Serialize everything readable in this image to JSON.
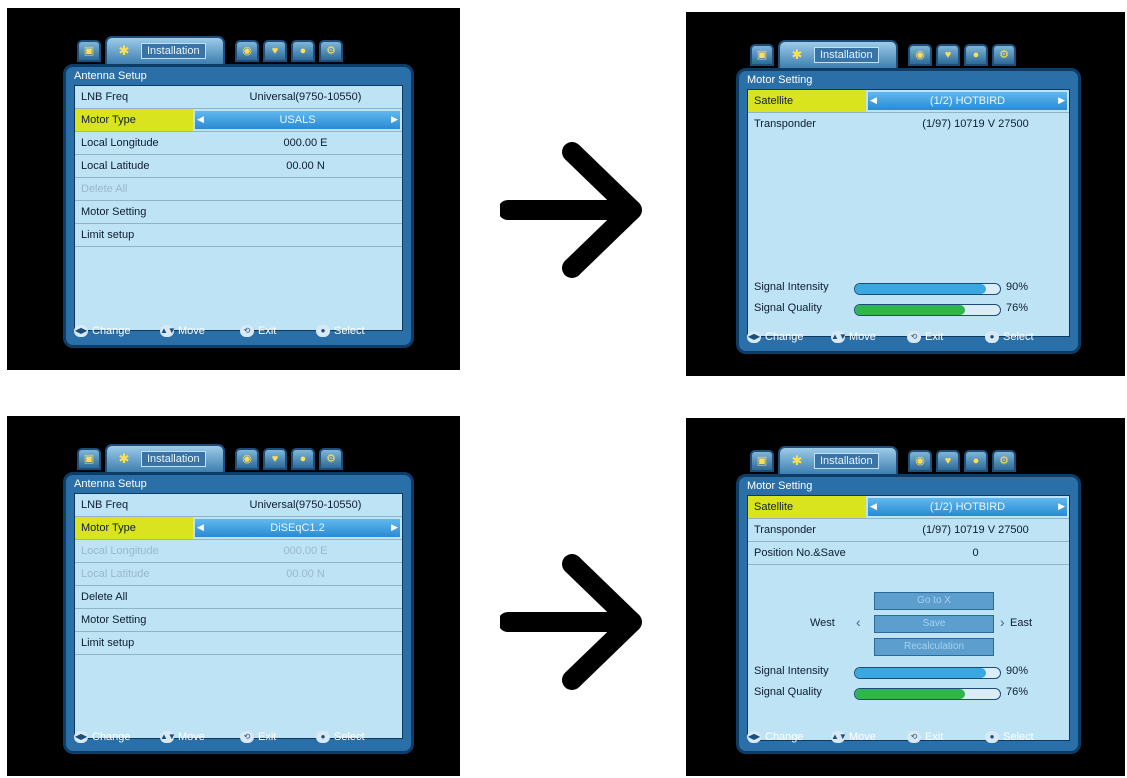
{
  "tabs": {
    "active_label": "Installation",
    "icons": [
      "tv-icon",
      "satellite-dish-icon",
      "parental-lock-icon",
      "favourite-icon",
      "system-icon",
      "settings-icon"
    ]
  },
  "screen_tl": {
    "title": "Antenna Setup",
    "rows": [
      {
        "label": "LNB Freq",
        "value": "Universal(9750-10550)"
      },
      {
        "label": "Motor Type",
        "value": "USALS"
      },
      {
        "label": "Local Longitude",
        "value": "000.00 E"
      },
      {
        "label": "Local Latitude",
        "value": "00.00 N"
      },
      {
        "label": "Delete All",
        "value": ""
      },
      {
        "label": "Motor Setting",
        "value": ""
      },
      {
        "label": "Limit setup",
        "value": ""
      }
    ]
  },
  "screen_bl": {
    "title": "Antenna Setup",
    "rows": [
      {
        "label": "LNB Freq",
        "value": "Universal(9750-10550)"
      },
      {
        "label": "Motor Type",
        "value": "DiSEqC1.2"
      },
      {
        "label": "Local Longitude",
        "value": "000.00 E"
      },
      {
        "label": "Local Latitude",
        "value": "00.00 N"
      },
      {
        "label": "Delete All",
        "value": ""
      },
      {
        "label": "Motor Setting",
        "value": ""
      },
      {
        "label": "Limit setup",
        "value": ""
      }
    ]
  },
  "screen_tr": {
    "title": "Motor Setting",
    "rows": [
      {
        "label": "Satellite",
        "value": "(1/2) HOTBIRD"
      },
      {
        "label": "Transponder",
        "value": "(1/97) 10719 V 27500"
      }
    ],
    "signal": {
      "intensity_label": "Signal Intensity",
      "intensity_value": 0.9,
      "intensity_text": "90%",
      "quality_label": "Signal Quality",
      "quality_value": 0.76,
      "quality_text": "76%"
    }
  },
  "screen_br": {
    "title": "Motor Setting",
    "rows": [
      {
        "label": "Satellite",
        "value": "(1/2) HOTBIRD"
      },
      {
        "label": "Transponder",
        "value": "(1/97) 10719 V 27500"
      },
      {
        "label": "Position No.&Save",
        "value": "0"
      }
    ],
    "buttons": {
      "goto": "Go to X",
      "save": "Save",
      "recalc": "Recalculation"
    },
    "west_label": "West",
    "east_label": "East",
    "signal": {
      "intensity_label": "Signal Intensity",
      "intensity_value": 0.9,
      "intensity_text": "90%",
      "quality_label": "Signal Quality",
      "quality_value": 0.76,
      "quality_text": "76%"
    }
  },
  "footer": {
    "change": "Change",
    "move": "Move",
    "exit": "Exit",
    "select": "Select"
  },
  "colors": {
    "selected_label_bg": "#d9e41f",
    "panel_bg": "#2a6fa8",
    "list_bg": "#bde3f4",
    "intensity_fill": "#3aa8e0",
    "quality_fill": "#2fb64a"
  }
}
